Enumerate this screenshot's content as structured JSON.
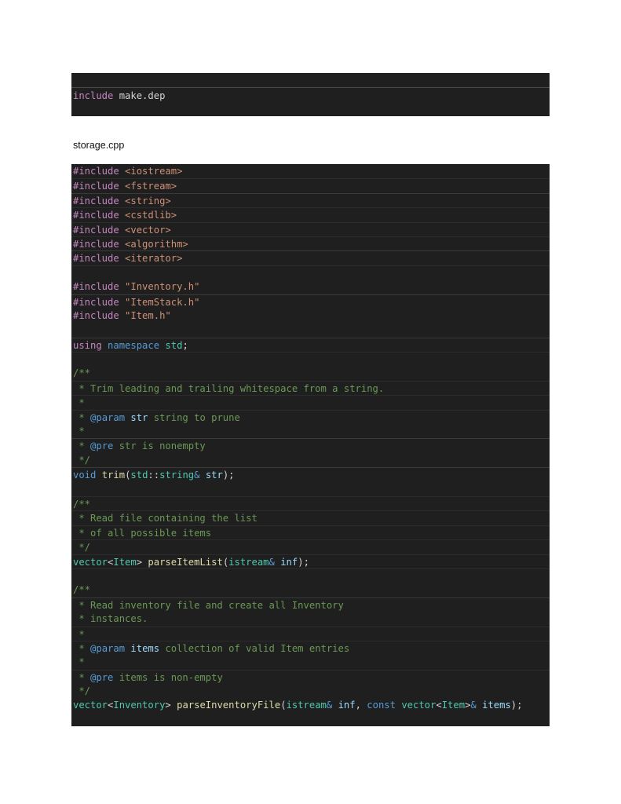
{
  "make_snippet": {
    "lines": [
      [
        {
          "t": "include",
          "c": "t-include-kw"
        },
        {
          "t": " make.dep",
          "c": "t-plain"
        }
      ]
    ]
  },
  "file_label": "storage.cpp",
  "storage_code": {
    "lines": [
      [
        {
          "t": "#include",
          "c": "t-directive"
        },
        {
          "t": " <iostream>",
          "c": "t-sys-header"
        }
      ],
      [
        {
          "t": "#include",
          "c": "t-directive"
        },
        {
          "t": " <fstream>",
          "c": "t-sys-header"
        }
      ],
      [
        {
          "t": "#include",
          "c": "t-directive"
        },
        {
          "t": " <string>",
          "c": "t-sys-header"
        }
      ],
      [
        {
          "t": "#include",
          "c": "t-directive"
        },
        {
          "t": " <cstdlib>",
          "c": "t-sys-header"
        }
      ],
      [
        {
          "t": "#include",
          "c": "t-directive"
        },
        {
          "t": " <vector>",
          "c": "t-sys-header"
        }
      ],
      [
        {
          "t": "#include",
          "c": "t-directive"
        },
        {
          "t": " <algorithm>",
          "c": "t-sys-header"
        }
      ],
      [
        {
          "t": "#include",
          "c": "t-directive"
        },
        {
          "t": " <iterator>",
          "c": "t-sys-header"
        }
      ],
      [],
      [
        {
          "t": "#include",
          "c": "t-directive"
        },
        {
          "t": " \"Inventory.h\"",
          "c": "t-string"
        }
      ],
      [
        {
          "t": "#include",
          "c": "t-directive"
        },
        {
          "t": " \"ItemStack.h\"",
          "c": "t-string"
        }
      ],
      [
        {
          "t": "#include",
          "c": "t-directive"
        },
        {
          "t": " \"Item.h\"",
          "c": "t-string"
        }
      ],
      [],
      [
        {
          "t": "using",
          "c": "t-control"
        },
        {
          "t": " ",
          "c": "t-plain"
        },
        {
          "t": "namespace",
          "c": "t-keyword"
        },
        {
          "t": " ",
          "c": "t-plain"
        },
        {
          "t": "std",
          "c": "t-ns"
        },
        {
          "t": ";",
          "c": "t-punct"
        }
      ],
      [],
      [
        {
          "t": "/**",
          "c": "t-comment"
        }
      ],
      [
        {
          "t": " * Trim leading and trailing whitespace from a string.",
          "c": "t-comment"
        }
      ],
      [
        {
          "t": " *",
          "c": "t-comment"
        }
      ],
      [
        {
          "t": " * ",
          "c": "t-comment"
        },
        {
          "t": "@param",
          "c": "t-doctag"
        },
        {
          "t": " ",
          "c": "t-comment"
        },
        {
          "t": "str",
          "c": "t-docparam"
        },
        {
          "t": " string to prune",
          "c": "t-comment"
        }
      ],
      [
        {
          "t": " *",
          "c": "t-comment"
        }
      ],
      [
        {
          "t": " * ",
          "c": "t-comment"
        },
        {
          "t": "@pre",
          "c": "t-doctag"
        },
        {
          "t": " str is nonempty",
          "c": "t-comment"
        }
      ],
      [
        {
          "t": " */",
          "c": "t-comment"
        }
      ],
      [
        {
          "t": "void",
          "c": "t-keyword"
        },
        {
          "t": " ",
          "c": "t-plain"
        },
        {
          "t": "trim",
          "c": "t-func"
        },
        {
          "t": "(",
          "c": "t-punct"
        },
        {
          "t": "std",
          "c": "t-ns"
        },
        {
          "t": "::",
          "c": "t-punct"
        },
        {
          "t": "string",
          "c": "t-type"
        },
        {
          "t": "&",
          "c": "t-amp"
        },
        {
          "t": " ",
          "c": "t-plain"
        },
        {
          "t": "str",
          "c": "t-param"
        },
        {
          "t": ");",
          "c": "t-punct"
        }
      ],
      [],
      [
        {
          "t": "/**",
          "c": "t-comment"
        }
      ],
      [
        {
          "t": " * Read file containing the list",
          "c": "t-comment"
        }
      ],
      [
        {
          "t": " * of all possible items",
          "c": "t-comment"
        }
      ],
      [
        {
          "t": " */",
          "c": "t-comment"
        }
      ],
      [
        {
          "t": "vector",
          "c": "t-type"
        },
        {
          "t": "<",
          "c": "t-punct"
        },
        {
          "t": "Item",
          "c": "t-type"
        },
        {
          "t": "> ",
          "c": "t-punct"
        },
        {
          "t": "parseItemList",
          "c": "t-func"
        },
        {
          "t": "(",
          "c": "t-punct"
        },
        {
          "t": "istream",
          "c": "t-type"
        },
        {
          "t": "&",
          "c": "t-amp"
        },
        {
          "t": " ",
          "c": "t-plain"
        },
        {
          "t": "inf",
          "c": "t-param"
        },
        {
          "t": ");",
          "c": "t-punct"
        }
      ],
      [],
      [
        {
          "t": "/**",
          "c": "t-comment"
        }
      ],
      [
        {
          "t": " * Read inventory file and create all Inventory",
          "c": "t-comment"
        }
      ],
      [
        {
          "t": " * instances.",
          "c": "t-comment"
        }
      ],
      [
        {
          "t": " *",
          "c": "t-comment"
        }
      ],
      [
        {
          "t": " * ",
          "c": "t-comment"
        },
        {
          "t": "@param",
          "c": "t-doctag"
        },
        {
          "t": " ",
          "c": "t-comment"
        },
        {
          "t": "items",
          "c": "t-docparam"
        },
        {
          "t": " collection of valid Item entries",
          "c": "t-comment"
        }
      ],
      [
        {
          "t": " *",
          "c": "t-comment"
        }
      ],
      [
        {
          "t": " * ",
          "c": "t-comment"
        },
        {
          "t": "@pre",
          "c": "t-doctag"
        },
        {
          "t": " items is non-empty",
          "c": "t-comment"
        }
      ],
      [
        {
          "t": " */",
          "c": "t-comment"
        }
      ],
      [
        {
          "t": "vector",
          "c": "t-type"
        },
        {
          "t": "<",
          "c": "t-punct"
        },
        {
          "t": "Inventory",
          "c": "t-type"
        },
        {
          "t": "> ",
          "c": "t-punct"
        },
        {
          "t": "parseInventoryFile",
          "c": "t-func"
        },
        {
          "t": "(",
          "c": "t-punct"
        },
        {
          "t": "istream",
          "c": "t-type"
        },
        {
          "t": "&",
          "c": "t-amp"
        },
        {
          "t": " ",
          "c": "t-plain"
        },
        {
          "t": "inf",
          "c": "t-param"
        },
        {
          "t": ", ",
          "c": "t-punct"
        },
        {
          "t": "const",
          "c": "t-keyword"
        },
        {
          "t": " ",
          "c": "t-plain"
        },
        {
          "t": "vector",
          "c": "t-type"
        },
        {
          "t": "<",
          "c": "t-punct"
        },
        {
          "t": "Item",
          "c": "t-type"
        },
        {
          "t": ">",
          "c": "t-punct"
        },
        {
          "t": "&",
          "c": "t-amp"
        },
        {
          "t": " ",
          "c": "t-plain"
        },
        {
          "t": "items",
          "c": "t-param"
        },
        {
          "t": ");",
          "c": "t-punct"
        }
      ]
    ]
  }
}
